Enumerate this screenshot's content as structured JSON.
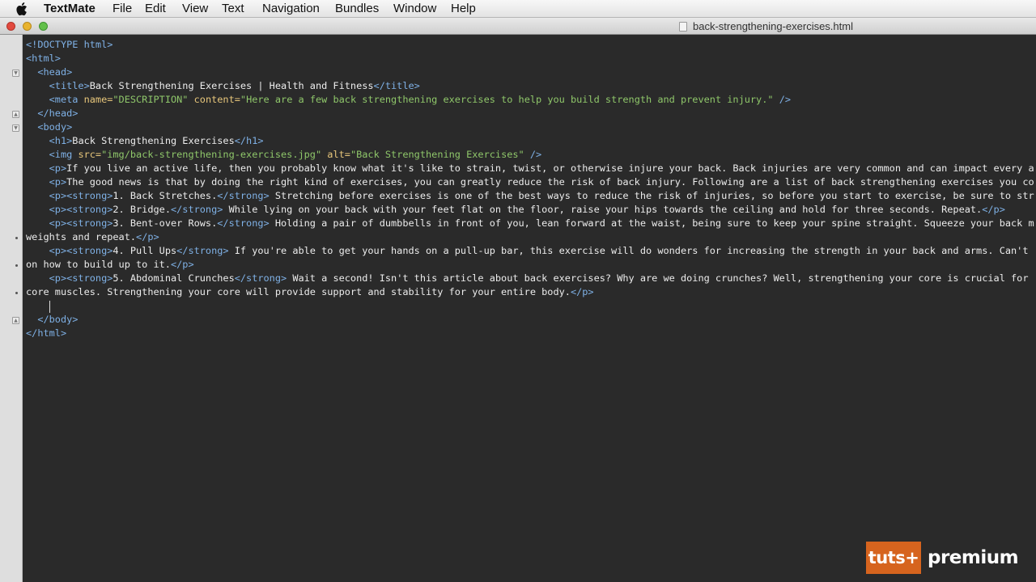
{
  "menubar": {
    "apple_icon": "apple-logo",
    "app_name": "TextMate",
    "items": [
      "File",
      "Edit",
      "View",
      "Text",
      "Navigation",
      "Bundles",
      "Window",
      "Help"
    ]
  },
  "window": {
    "title": "back-strengthening-exercises.html",
    "document_icon": "html-document-icon"
  },
  "colors": {
    "editor_background": "#2a2a2a",
    "tag": "#7fb1e6",
    "attribute": "#e8c77b",
    "string": "#8fc76a",
    "text": "#ececec",
    "watermark_orange": "#d6641e"
  },
  "editor": {
    "lines": [
      [
        [
          "tag",
          "<!DOCTYPE html>"
        ]
      ],
      [
        [
          "tag",
          "<html>"
        ]
      ],
      [
        [
          "txt",
          "  "
        ],
        [
          "tag",
          "<head>"
        ]
      ],
      [
        [
          "txt",
          "    "
        ],
        [
          "tag",
          "<title>"
        ],
        [
          "txt",
          "Back Strengthening Exercises | Health and Fitness"
        ],
        [
          "tag",
          "</title>"
        ]
      ],
      [
        [
          "txt",
          "    "
        ],
        [
          "tag",
          "<meta "
        ],
        [
          "attr",
          "name="
        ],
        [
          "str",
          "\"DESCRIPTION\""
        ],
        [
          "txt",
          " "
        ],
        [
          "attr",
          "content="
        ],
        [
          "str",
          "\"Here are a few back strengthening exercises to help you build strength and prevent injury.\""
        ],
        [
          "tag",
          " />"
        ]
      ],
      [
        [
          "txt",
          "  "
        ],
        [
          "tag",
          "</head>"
        ]
      ],
      [
        [
          "txt",
          "  "
        ],
        [
          "tag",
          "<body>"
        ]
      ],
      [
        [
          "txt",
          "    "
        ],
        [
          "tag",
          "<h1>"
        ],
        [
          "txt",
          "Back Strengthening Exercises"
        ],
        [
          "tag",
          "</h1>"
        ]
      ],
      [
        [
          "txt",
          "    "
        ],
        [
          "tag",
          "<img "
        ],
        [
          "attr",
          "src="
        ],
        [
          "str",
          "\"img/back-strengthening-exercises.jpg\""
        ],
        [
          "txt",
          " "
        ],
        [
          "attr",
          "alt="
        ],
        [
          "str",
          "\"Back Strengthening Exercises\""
        ],
        [
          "tag",
          " />"
        ]
      ],
      [
        [
          "txt",
          "    "
        ],
        [
          "tag",
          "<p>"
        ],
        [
          "txt",
          "If you live an active life, then you probably know what it's like to strain, twist, or otherwise injure your back. Back injuries are very common and can impact every a"
        ]
      ],
      [
        [
          "txt",
          "    "
        ],
        [
          "tag",
          "<p>"
        ],
        [
          "txt",
          "The good news is that by doing the right kind of exercises, you can greatly reduce the risk of back injury. Following are a list of back strengthening exercises you co"
        ]
      ],
      [
        [
          "txt",
          "    "
        ],
        [
          "tag",
          "<p><strong>"
        ],
        [
          "txt",
          "1. Back Stretches."
        ],
        [
          "tag",
          "</strong>"
        ],
        [
          "txt",
          " Stretching before exercises is one of the best ways to reduce the risk of injuries, so before you start to exercise, be sure to str"
        ]
      ],
      [
        [
          "txt",
          "    "
        ],
        [
          "tag",
          "<p><strong>"
        ],
        [
          "txt",
          "2. Bridge."
        ],
        [
          "tag",
          "</strong>"
        ],
        [
          "txt",
          " While lying on your back with your feet flat on the floor, raise your hips towards the ceiling and hold for three seconds. Repeat."
        ],
        [
          "tag",
          "</p>"
        ]
      ],
      [
        [
          "txt",
          "    "
        ],
        [
          "tag",
          "<p><strong>"
        ],
        [
          "txt",
          "3. Bent-over Rows."
        ],
        [
          "tag",
          "</strong>"
        ],
        [
          "txt",
          " Holding a pair of dumbbells in front of you, lean forward at the waist, being sure to keep your spine straight. Squeeze your back m"
        ]
      ],
      [
        [
          "txt",
          "weights and repeat."
        ],
        [
          "tag",
          "</p>"
        ]
      ],
      [
        [
          "txt",
          "    "
        ],
        [
          "tag",
          "<p><strong>"
        ],
        [
          "txt",
          "4. Pull Ups"
        ],
        [
          "tag",
          "</strong>"
        ],
        [
          "txt",
          " If you're able to get your hands on a pull-up bar, this exercise will do wonders for increasing the strength in your back and arms. Can't"
        ]
      ],
      [
        [
          "txt",
          "on how to build up to it."
        ],
        [
          "tag",
          "</p>"
        ]
      ],
      [
        [
          "txt",
          "    "
        ],
        [
          "tag",
          "<p><strong>"
        ],
        [
          "txt",
          "5. Abdominal Crunches"
        ],
        [
          "tag",
          "</strong>"
        ],
        [
          "txt",
          " Wait a second! Isn't this article about back exercises? Why are we doing crunches? Well, strengthening your core is crucial for"
        ]
      ],
      [
        [
          "txt",
          "core muscles. Strengthening your core will provide support and stability for your entire body."
        ],
        [
          "tag",
          "</p>"
        ]
      ],
      [
        [
          "txt",
          ""
        ]
      ],
      [
        [
          "txt",
          "  "
        ],
        [
          "tag",
          "</body>"
        ]
      ],
      [
        [
          "tag",
          "</html>"
        ]
      ]
    ]
  },
  "watermark": {
    "brand": "tuts+",
    "tier": "premium"
  }
}
